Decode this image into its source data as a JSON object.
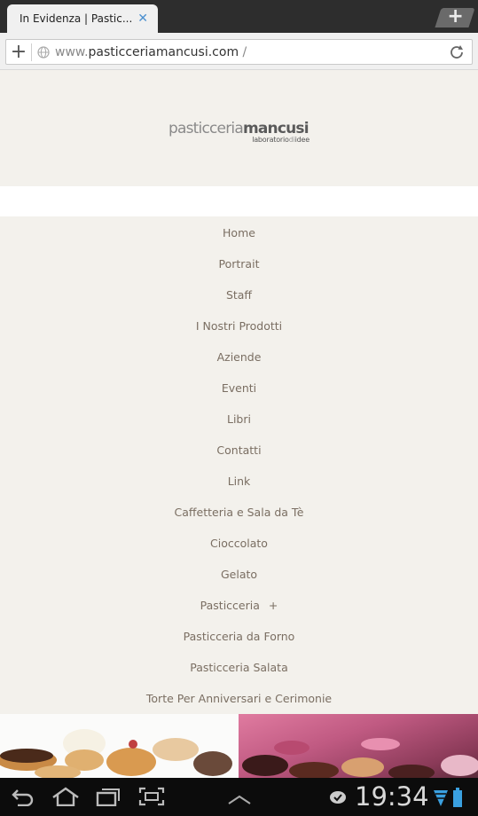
{
  "browser": {
    "tab_title": "In Evidenza | Pastic...",
    "tab_close_icon": "close-icon",
    "new_tab_label": "+",
    "url_domain": "www.",
    "url_host": "pasticceriamancusi.com",
    "url_path": " /",
    "reload_icon": "reload-icon"
  },
  "site": {
    "logo_light": "pasticceria",
    "logo_bold": "mancusi",
    "logo_sub_a": "laboratorio",
    "logo_sub_b": "di",
    "logo_sub_c": "idee"
  },
  "menu": [
    {
      "label": "Home"
    },
    {
      "label": "Portrait"
    },
    {
      "label": "Staff"
    },
    {
      "label": "I Nostri Prodotti"
    },
    {
      "label": "Aziende"
    },
    {
      "label": "Eventi"
    },
    {
      "label": "Libri"
    },
    {
      "label": "Contatti"
    },
    {
      "label": "Link"
    },
    {
      "label": "Caffetteria e Sala da Tè"
    },
    {
      "label": "Cioccolato"
    },
    {
      "label": "Gelato"
    },
    {
      "label": "Pasticceria",
      "expander": "+"
    },
    {
      "label": "Pasticceria da Forno"
    },
    {
      "label": "Pasticceria Salata"
    },
    {
      "label": "Torte Per Anniversari e Cerimonie"
    }
  ],
  "system_bar": {
    "clock": "19:34",
    "icons": [
      "back-icon",
      "home-icon",
      "recent-apps-icon",
      "screenshot-icon",
      "menu-up-icon",
      "notification-icon",
      "wifi-icon",
      "battery-icon"
    ]
  },
  "colors": {
    "page_bg": "#f3f1ec",
    "menu_text": "#7a6e62",
    "tab_close": "#4a8fcf",
    "wifi": "#3aa0e0"
  }
}
